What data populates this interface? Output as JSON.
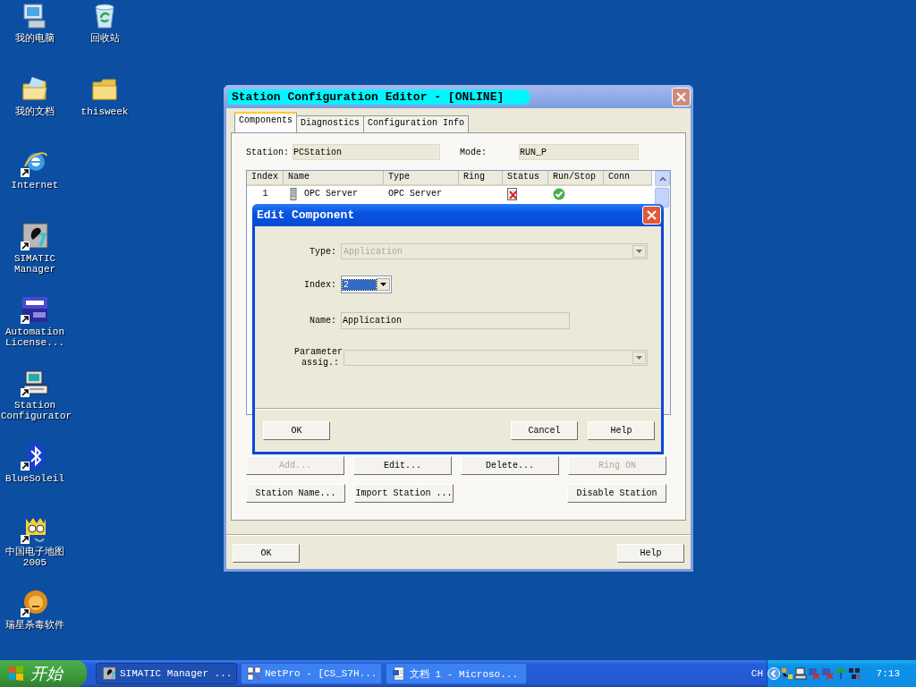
{
  "desktop_icons": [
    {
      "label": "我的电脑",
      "kind": "computer",
      "shortcut": false
    },
    {
      "label": "我的文档",
      "kind": "documents",
      "shortcut": false
    },
    {
      "label": "Internet",
      "kind": "browser",
      "shortcut": true
    },
    {
      "label": "SIMATIC Manager",
      "kind": "simatic",
      "shortcut": true
    },
    {
      "label": "Automation License...",
      "kind": "license",
      "shortcut": true
    },
    {
      "label": "Station Configurator",
      "kind": "station",
      "shortcut": true
    },
    {
      "label": "BlueSoleil",
      "kind": "bluetooth",
      "shortcut": true
    },
    {
      "label": "中国电子地图 2005",
      "kind": "map",
      "shortcut": true
    },
    {
      "label": "瑞星杀毒软件",
      "kind": "antivirus",
      "shortcut": true
    },
    {
      "label": "回收站",
      "kind": "recycle",
      "shortcut": false
    },
    {
      "label": "thisweek",
      "kind": "folder",
      "shortcut": false
    }
  ],
  "main_window": {
    "title": "Station Configuration Editor - [ONLINE]",
    "tabs": [
      {
        "label": "Components",
        "selected": true
      },
      {
        "label": "Diagnostics",
        "selected": false
      },
      {
        "label": "Configuration Info",
        "selected": false
      }
    ],
    "station_label": "Station:",
    "station_value": "PCStation",
    "mode_label": "Mode:",
    "mode_value": "RUN_P",
    "table": {
      "columns": [
        "Index",
        "Name",
        "Type",
        "Ring",
        "Status",
        "Run/Stop",
        "Conn"
      ],
      "rows": [
        {
          "index": "1",
          "name": "OPC Server",
          "type": "OPC Server",
          "status_error": true,
          "running": true
        }
      ]
    },
    "button_rows": [
      [
        {
          "label": "Add...",
          "disabled": true
        },
        {
          "label": "Edit...",
          "disabled": false
        },
        {
          "label": "Delete...",
          "disabled": false
        },
        {
          "label": "Ring ON",
          "disabled": true
        }
      ],
      [
        {
          "label": "Station Name...",
          "disabled": false
        },
        {
          "label": "Import Station ...",
          "disabled": false
        },
        {
          "label": "Disable Station",
          "disabled": false
        }
      ]
    ],
    "footer_buttons": [
      "OK",
      "Help"
    ]
  },
  "edit_dialog": {
    "title": "Edit Component",
    "type": {
      "label": "Type:",
      "value": "Application",
      "disabled": true
    },
    "index": {
      "label": "Index:",
      "value": "2",
      "highlighted": true
    },
    "name": {
      "label": "Name:",
      "value": "Application"
    },
    "parameter": {
      "label": "Parameter assig.:",
      "disabled": true
    },
    "buttons": [
      "OK",
      "Cancel",
      "Help"
    ]
  },
  "taskbar": {
    "start": "开始",
    "tasks": [
      {
        "label": "SIMATIC Manager ...",
        "kind": "simatic",
        "selected": true
      },
      {
        "label": "NetPro - [CS_S7H...",
        "kind": "netpro",
        "selected": false
      },
      {
        "label": "文档 1 - Microso...",
        "kind": "word",
        "selected": false
      }
    ],
    "language": "CH",
    "clock": "7:13"
  }
}
